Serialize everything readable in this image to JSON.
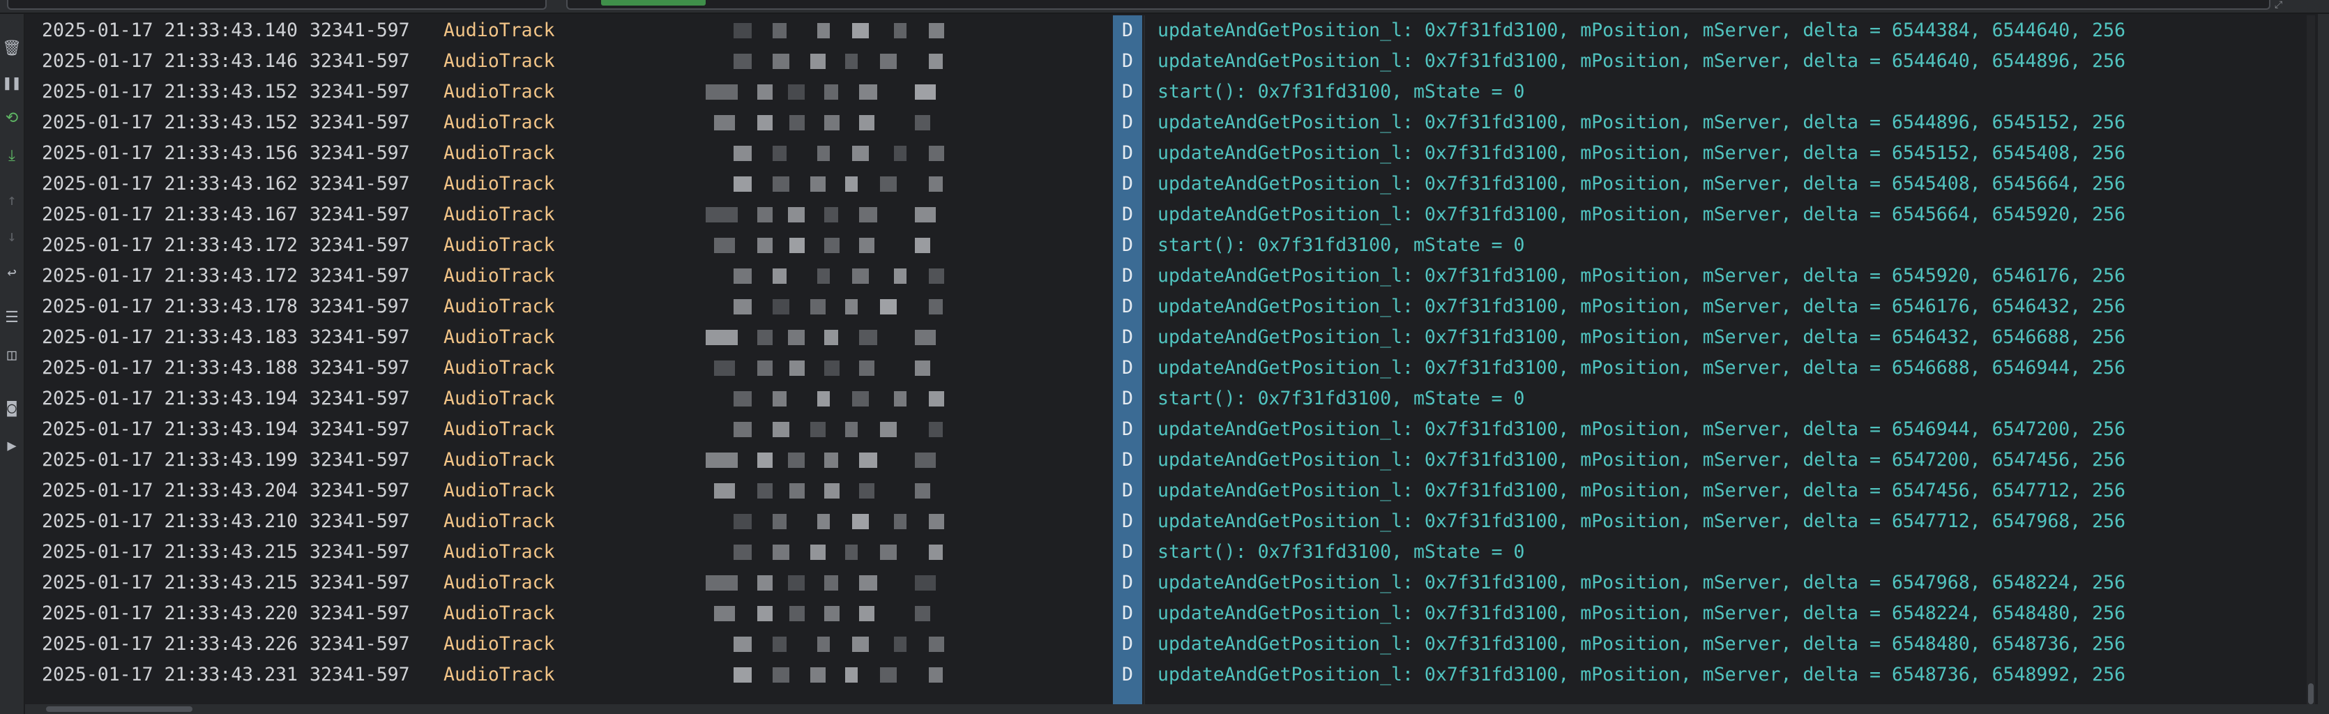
{
  "window": {
    "corner_icon": "expand-icon"
  },
  "toolbar": {
    "icons": [
      {
        "name": "trash-icon",
        "glyph": "🗑"
      },
      {
        "name": "pause-icon",
        "glyph": "❚❚"
      },
      {
        "name": "restart-icon",
        "glyph": "⟲"
      },
      {
        "name": "scroll-to-end-icon",
        "glyph": "⤓"
      },
      {
        "name": "up-arrow-icon",
        "glyph": "↑"
      },
      {
        "name": "down-arrow-icon",
        "glyph": "↓"
      },
      {
        "name": "soft-wrap-icon",
        "glyph": "↩"
      },
      {
        "name": "filter-settings-icon",
        "glyph": "☰"
      },
      {
        "name": "split-view-icon",
        "glyph": "◫"
      },
      {
        "name": "screenshot-icon",
        "glyph": "◙"
      },
      {
        "name": "screen-record-icon",
        "glyph": "▶"
      }
    ]
  },
  "log": {
    "level_label": "D",
    "colors": {
      "timestamp": "#d0d2d6",
      "tag": "#f2c487",
      "message": "#51c4c0",
      "level_bg": "#3b6b94",
      "background": "#1e1f22"
    },
    "rows": [
      {
        "timestamp": "2025-01-17 21:33:43.140",
        "pid": "32341-597",
        "tag": "AudioTrack",
        "level": "D",
        "message": "updateAndGetPosition_l: 0x7f31fd3100, mPosition, mServer, delta = 6544384, 6544640, 256"
      },
      {
        "timestamp": "2025-01-17 21:33:43.146",
        "pid": "32341-597",
        "tag": "AudioTrack",
        "level": "D",
        "message": "updateAndGetPosition_l: 0x7f31fd3100, mPosition, mServer, delta = 6544640, 6544896, 256"
      },
      {
        "timestamp": "2025-01-17 21:33:43.152",
        "pid": "32341-597",
        "tag": "AudioTrack",
        "level": "D",
        "message": "start(): 0x7f31fd3100, mState = 0"
      },
      {
        "timestamp": "2025-01-17 21:33:43.152",
        "pid": "32341-597",
        "tag": "AudioTrack",
        "level": "D",
        "message": "updateAndGetPosition_l: 0x7f31fd3100, mPosition, mServer, delta = 6544896, 6545152, 256"
      },
      {
        "timestamp": "2025-01-17 21:33:43.156",
        "pid": "32341-597",
        "tag": "AudioTrack",
        "level": "D",
        "message": "updateAndGetPosition_l: 0x7f31fd3100, mPosition, mServer, delta = 6545152, 6545408, 256"
      },
      {
        "timestamp": "2025-01-17 21:33:43.162",
        "pid": "32341-597",
        "tag": "AudioTrack",
        "level": "D",
        "message": "updateAndGetPosition_l: 0x7f31fd3100, mPosition, mServer, delta = 6545408, 6545664, 256"
      },
      {
        "timestamp": "2025-01-17 21:33:43.167",
        "pid": "32341-597",
        "tag": "AudioTrack",
        "level": "D",
        "message": "updateAndGetPosition_l: 0x7f31fd3100, mPosition, mServer, delta = 6545664, 6545920, 256"
      },
      {
        "timestamp": "2025-01-17 21:33:43.172",
        "pid": "32341-597",
        "tag": "AudioTrack",
        "level": "D",
        "message": "start(): 0x7f31fd3100, mState = 0"
      },
      {
        "timestamp": "2025-01-17 21:33:43.172",
        "pid": "32341-597",
        "tag": "AudioTrack",
        "level": "D",
        "message": "updateAndGetPosition_l: 0x7f31fd3100, mPosition, mServer, delta = 6545920, 6546176, 256"
      },
      {
        "timestamp": "2025-01-17 21:33:43.178",
        "pid": "32341-597",
        "tag": "AudioTrack",
        "level": "D",
        "message": "updateAndGetPosition_l: 0x7f31fd3100, mPosition, mServer, delta = 6546176, 6546432, 256"
      },
      {
        "timestamp": "2025-01-17 21:33:43.183",
        "pid": "32341-597",
        "tag": "AudioTrack",
        "level": "D",
        "message": "updateAndGetPosition_l: 0x7f31fd3100, mPosition, mServer, delta = 6546432, 6546688, 256"
      },
      {
        "timestamp": "2025-01-17 21:33:43.188",
        "pid": "32341-597",
        "tag": "AudioTrack",
        "level": "D",
        "message": "updateAndGetPosition_l: 0x7f31fd3100, mPosition, mServer, delta = 6546688, 6546944, 256"
      },
      {
        "timestamp": "2025-01-17 21:33:43.194",
        "pid": "32341-597",
        "tag": "AudioTrack",
        "level": "D",
        "message": "start(): 0x7f31fd3100, mState = 0"
      },
      {
        "timestamp": "2025-01-17 21:33:43.194",
        "pid": "32341-597",
        "tag": "AudioTrack",
        "level": "D",
        "message": "updateAndGetPosition_l: 0x7f31fd3100, mPosition, mServer, delta = 6546944, 6547200, 256"
      },
      {
        "timestamp": "2025-01-17 21:33:43.199",
        "pid": "32341-597",
        "tag": "AudioTrack",
        "level": "D",
        "message": "updateAndGetPosition_l: 0x7f31fd3100, mPosition, mServer, delta = 6547200, 6547456, 256"
      },
      {
        "timestamp": "2025-01-17 21:33:43.204",
        "pid": "32341-597",
        "tag": "AudioTrack",
        "level": "D",
        "message": "updateAndGetPosition_l: 0x7f31fd3100, mPosition, mServer, delta = 6547456, 6547712, 256"
      },
      {
        "timestamp": "2025-01-17 21:33:43.210",
        "pid": "32341-597",
        "tag": "AudioTrack",
        "level": "D",
        "message": "updateAndGetPosition_l: 0x7f31fd3100, mPosition, mServer, delta = 6547712, 6547968, 256"
      },
      {
        "timestamp": "2025-01-17 21:33:43.215",
        "pid": "32341-597",
        "tag": "AudioTrack",
        "level": "D",
        "message": "start(): 0x7f31fd3100, mState = 0"
      },
      {
        "timestamp": "2025-01-17 21:33:43.215",
        "pid": "32341-597",
        "tag": "AudioTrack",
        "level": "D",
        "message": "updateAndGetPosition_l: 0x7f31fd3100, mPosition, mServer, delta = 6547968, 6548224, 256"
      },
      {
        "timestamp": "2025-01-17 21:33:43.220",
        "pid": "32341-597",
        "tag": "AudioTrack",
        "level": "D",
        "message": "updateAndGetPosition_l: 0x7f31fd3100, mPosition, mServer, delta = 6548224, 6548480, 256"
      },
      {
        "timestamp": "2025-01-17 21:33:43.226",
        "pid": "32341-597",
        "tag": "AudioTrack",
        "level": "D",
        "message": "updateAndGetPosition_l: 0x7f31fd3100, mPosition, mServer, delta = 6548480, 6548736, 256"
      },
      {
        "timestamp": "2025-01-17 21:33:43.231",
        "pid": "32341-597",
        "tag": "AudioTrack",
        "level": "D",
        "message": "updateAndGetPosition_l: 0x7f31fd3100, mPosition, mServer, delta = 6548736, 6548992, 256"
      }
    ]
  }
}
